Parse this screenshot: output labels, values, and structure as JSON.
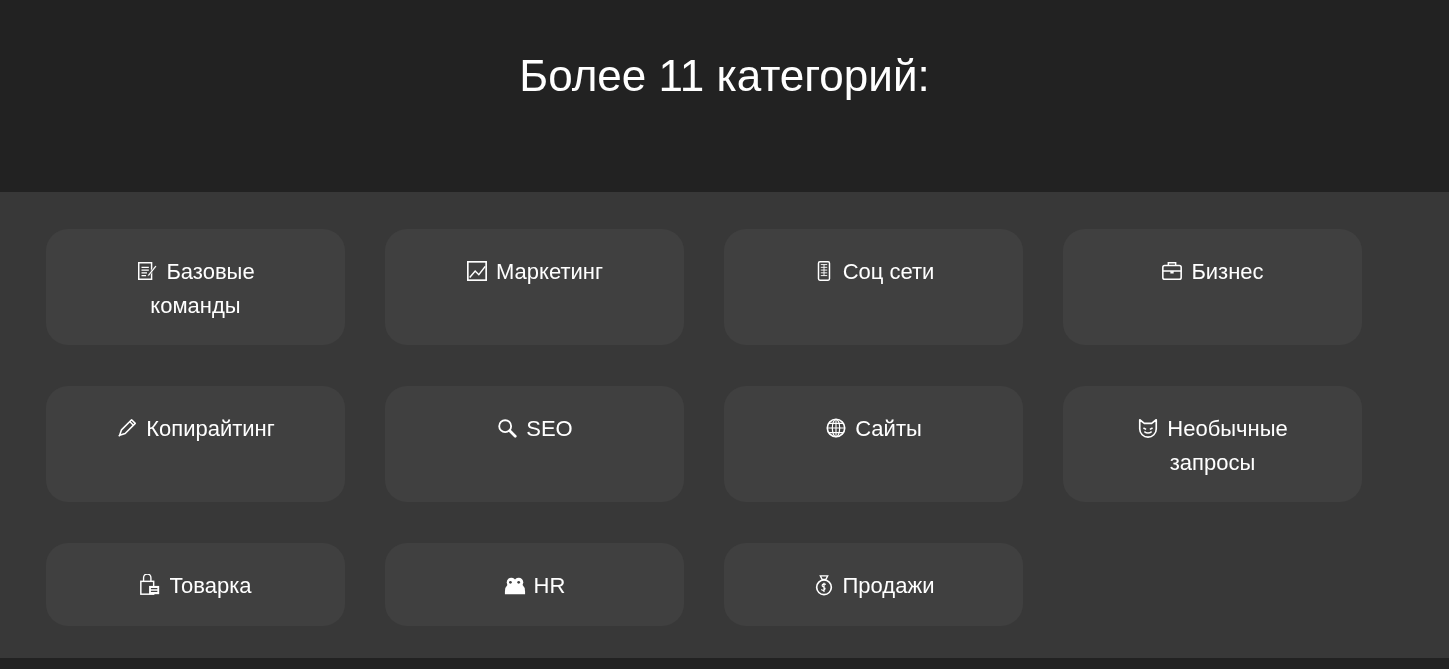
{
  "header": {
    "title": "Более 11 категорий:"
  },
  "categories": [
    {
      "label": "Базовые команды"
    },
    {
      "label": "Маркетинг"
    },
    {
      "label": "Соц сети"
    },
    {
      "label": "Бизнес"
    },
    {
      "label": "Копирайтинг"
    },
    {
      "label": "SEO"
    },
    {
      "label": "Сайты"
    },
    {
      "label": "Необычные запросы"
    },
    {
      "label": "Товарка"
    },
    {
      "label": "HR"
    },
    {
      "label": "Продажи"
    }
  ]
}
